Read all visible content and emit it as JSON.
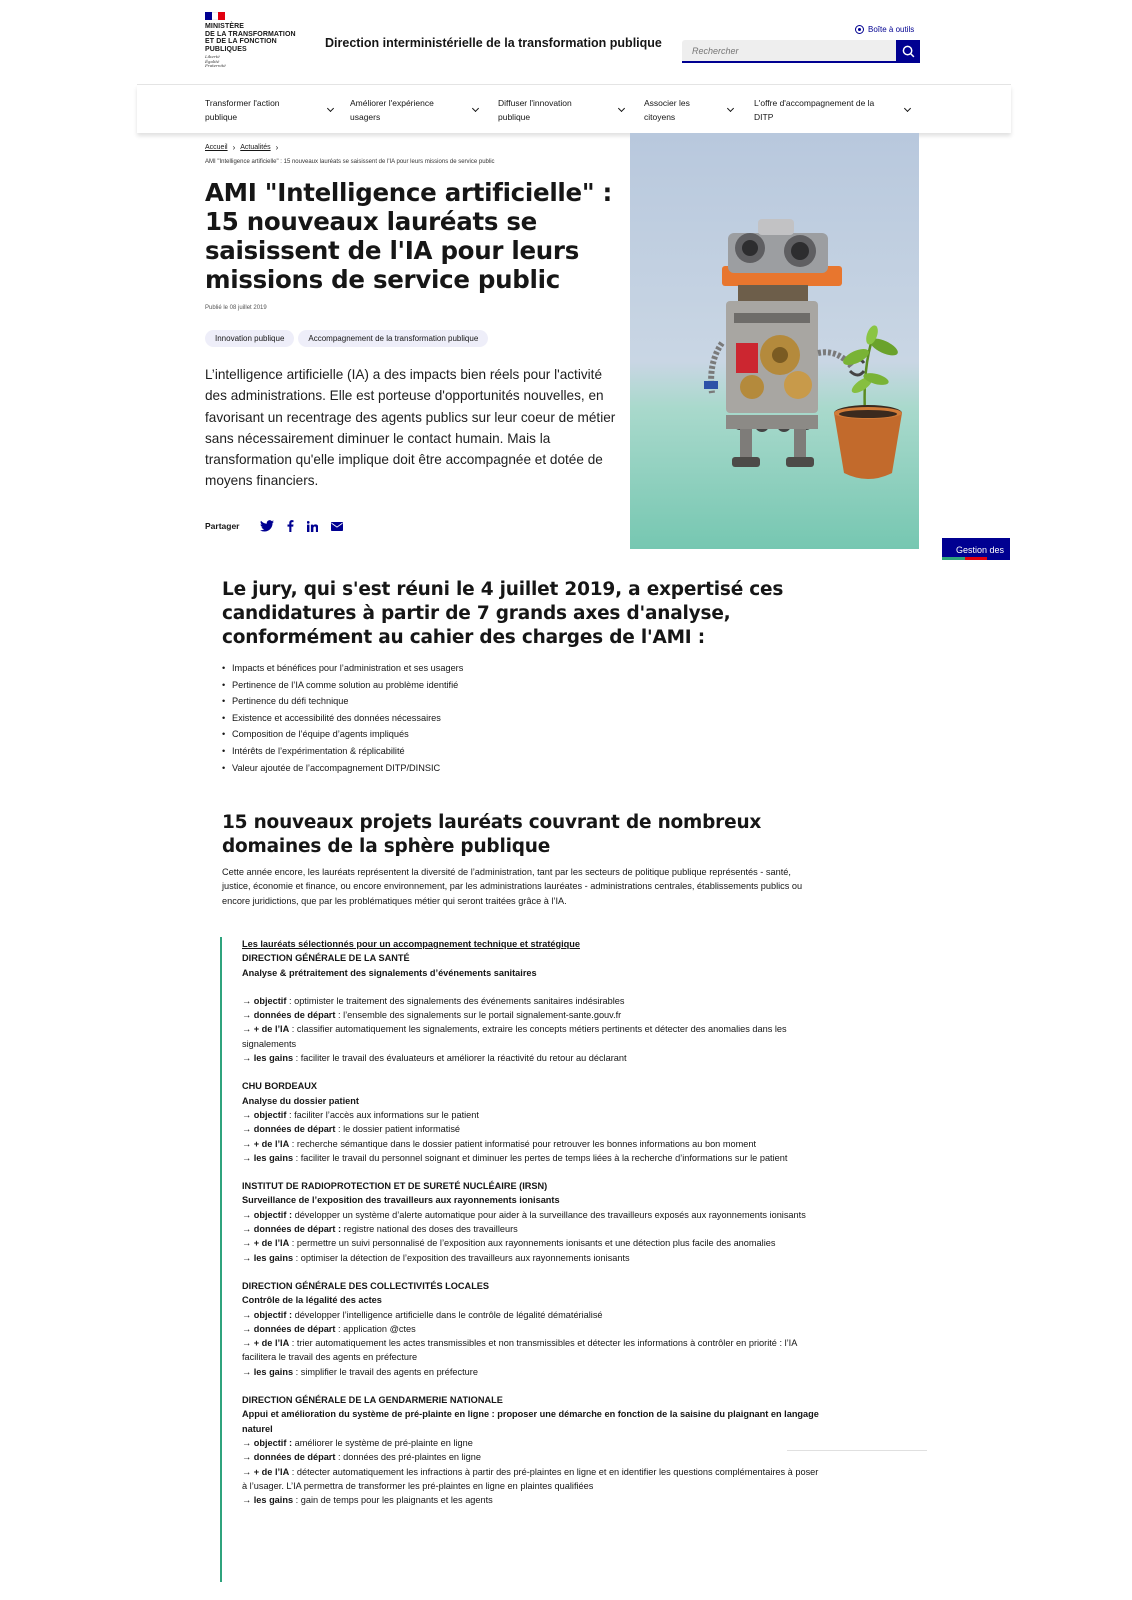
{
  "header": {
    "ministry_lines": "Ministère\nde la transformation\net de la fonction\npubliques",
    "motto": "Liberté\nÉgalité\nFraternité",
    "service_title": "Direction interministérielle de la transformation publique",
    "tools_label": "Boîte à outils",
    "search_placeholder": "Rechercher"
  },
  "nav": {
    "items": [
      {
        "label": "Transformer l'action\npublique"
      },
      {
        "label": "Améliorer l'expérience\nusagers"
      },
      {
        "label": "Diffuser l'innovation\npublique"
      },
      {
        "label": "Associer les\ncitoyens"
      },
      {
        "label": "L'offre d'accompagnement de la\nDITP"
      }
    ]
  },
  "breadcrumb": {
    "home": "Accueil",
    "news": "Actualités",
    "current": "AMI \"Intelligence artificielle\" : 15 nouveaux lauréats se saisissent de l'IA pour leurs missions de service public"
  },
  "article": {
    "title": "AMI \"Intelligence artificielle\" : 15 nouveaux lauréats se saisissent de l'IA pour leurs missions de service public",
    "published": "Publié le 08 juillet 2019",
    "tags": [
      "Innovation publique",
      "Accompagnement de la transformation publique"
    ],
    "lead": "L’intelligence artificielle (IA) a des impacts bien réels pour l'activité des administrations. Elle est porteuse d'opportunités nouvelles, en favorisant un recentrage des agents publics sur leur coeur de métier sans nécessairement diminuer le contact humain. Mais la transformation qu'elle implique doit être accompagnée et dotée de moyens financiers.",
    "share_label": "Partager"
  },
  "side_tab": "Gestion des",
  "section1": {
    "title": "Le jury, qui s'est réuni le 4 juillet 2019, a expertisé ces candidatures à partir de 7 grands axes d'analyse, conformément au cahier des charges de l'AMI :",
    "criteria": [
      "Impacts et bénéfices pour l’administration et ses usagers",
      "Pertinence de l’IA comme solution au problème identifié",
      "Pertinence du défi technique",
      "Existence et accessibilité des données nécessaires",
      "Composition de l’équipe d’agents impliqués",
      "Intérêts de l’expérimentation & réplicabilité",
      "Valeur ajoutée de l’accompagnement DITP/DINSIC"
    ]
  },
  "section2": {
    "title": "15 nouveaux projets lauréats couvrant de nombreux domaines de la sphère publique",
    "intro": "Cette année encore, les lauréats représentent la diversité de l’administration, tant par les secteurs de politique publique représentés - santé, justice, économie et finance, ou encore environnement, par les administrations lauréates - administrations centrales, établissements publics ou encore juridictions, que par les problématiques métier qui seront traitées grâce à l’IA."
  },
  "winners": {
    "heading": "Les lauréats sélectionnés pour un accompagnement technique et stratégique",
    "blocks": [
      {
        "org": "Direction générale de la santé",
        "project": "Analyse & prétraitement des signalements d’événements sanitaires",
        "lines": [
          {
            "k": "objectif",
            "v": " : optimister le traitement des signalements des événements sanitaires indésirables"
          },
          {
            "k": "données de départ",
            "v": " : l’ensemble des signalements sur le portail signalement-sante.gouv.fr"
          },
          {
            "k": "+ de l’IA",
            "v": " : classifier automatiquement les signalements, extraire les concepts métiers pertinents et détecter des anomalies dans les signalements"
          },
          {
            "k": "les gains",
            "v": " : faciliter le travail des évaluateurs et améliorer la réactivité du retour au déclarant"
          }
        ]
      },
      {
        "org": "CHU Bordeaux",
        "project": "Analyse du dossier patient",
        "lines": [
          {
            "k": "objectif",
            "v": " : faciliter l’accès aux informations sur le patient"
          },
          {
            "k": "données de départ",
            "v": " : le dossier patient informatisé"
          },
          {
            "k": "+ de l’IA",
            "v": " : recherche sémantique dans le dossier patient informatisé pour retrouver les bonnes informations au bon moment"
          },
          {
            "k": "les gains",
            "v": " : faciliter le travail du personnel soignant et diminuer les pertes de temps liées à la recherche d’informations sur le patient"
          }
        ]
      },
      {
        "org": "Institut de radioprotection et de sureté nucléaire (IRSN)",
        "project": "Surveillance de l’exposition des travailleurs aux rayonnements ionisants",
        "lines": [
          {
            "k": "objectif :",
            "v": " développer un système d’alerte automatique pour aider à la surveillance des travailleurs exposés aux rayonnements ionisants"
          },
          {
            "k": "données de départ :",
            "v": " registre national des doses des travailleurs"
          },
          {
            "k": "+ de l’IA",
            "v": " : permettre un suivi personnalisé de l’exposition aux rayonnements ionisants et une détection plus facile des anomalies"
          },
          {
            "k": "les gains",
            "v": " : optimiser la détection de l’exposition des travailleurs aux rayonnements ionisants"
          }
        ]
      },
      {
        "org": "Direction générale des collectivités locales",
        "project": "Contrôle de la légalité des actes",
        "lines": [
          {
            "k": "objectif :",
            "v": " développer l’intelligence artificielle dans le contrôle de légalité dématérialisé"
          },
          {
            "k": "données de départ",
            "v": " : application @ctes"
          },
          {
            "k": "+ de l’IA",
            "v": " : trier automatiquement les actes transmissibles et non transmissibles et détecter les informations à contrôler en priorité : l’IA facilitera le travail des agents en préfecture"
          },
          {
            "k": "les gains",
            "v": " : simplifier le travail des agents en préfecture"
          }
        ]
      },
      {
        "org": "Direction générale de la gendarmerie nationale",
        "project": "Appui et amélioration du système de pré-plainte en ligne : proposer une démarche en fonction de la saisine du plaignant en langage naturel",
        "lines": [
          {
            "k": "objectif :",
            "v": " améliorer le système de pré-plainte en ligne"
          },
          {
            "k": "données de départ",
            "v": " : données des pré-plaintes en ligne"
          },
          {
            "k": "+ de l’IA",
            "v": " : détecter automatiquement les infractions à partir des pré-plaintes en ligne et en identifier les questions complémentaires à poser à l’usager. L’IA permettra de transformer les pré-plaintes en ligne en plaintes qualifiées"
          },
          {
            "k": "les gains",
            "v": " : gain de temps pour les plaignants et les agents"
          }
        ]
      }
    ]
  },
  "colors": {
    "blue_france": "#000091",
    "red_marianne": "#e1000f",
    "accent_green": "#2fa37d",
    "tag_bg": "#eeeef9"
  }
}
